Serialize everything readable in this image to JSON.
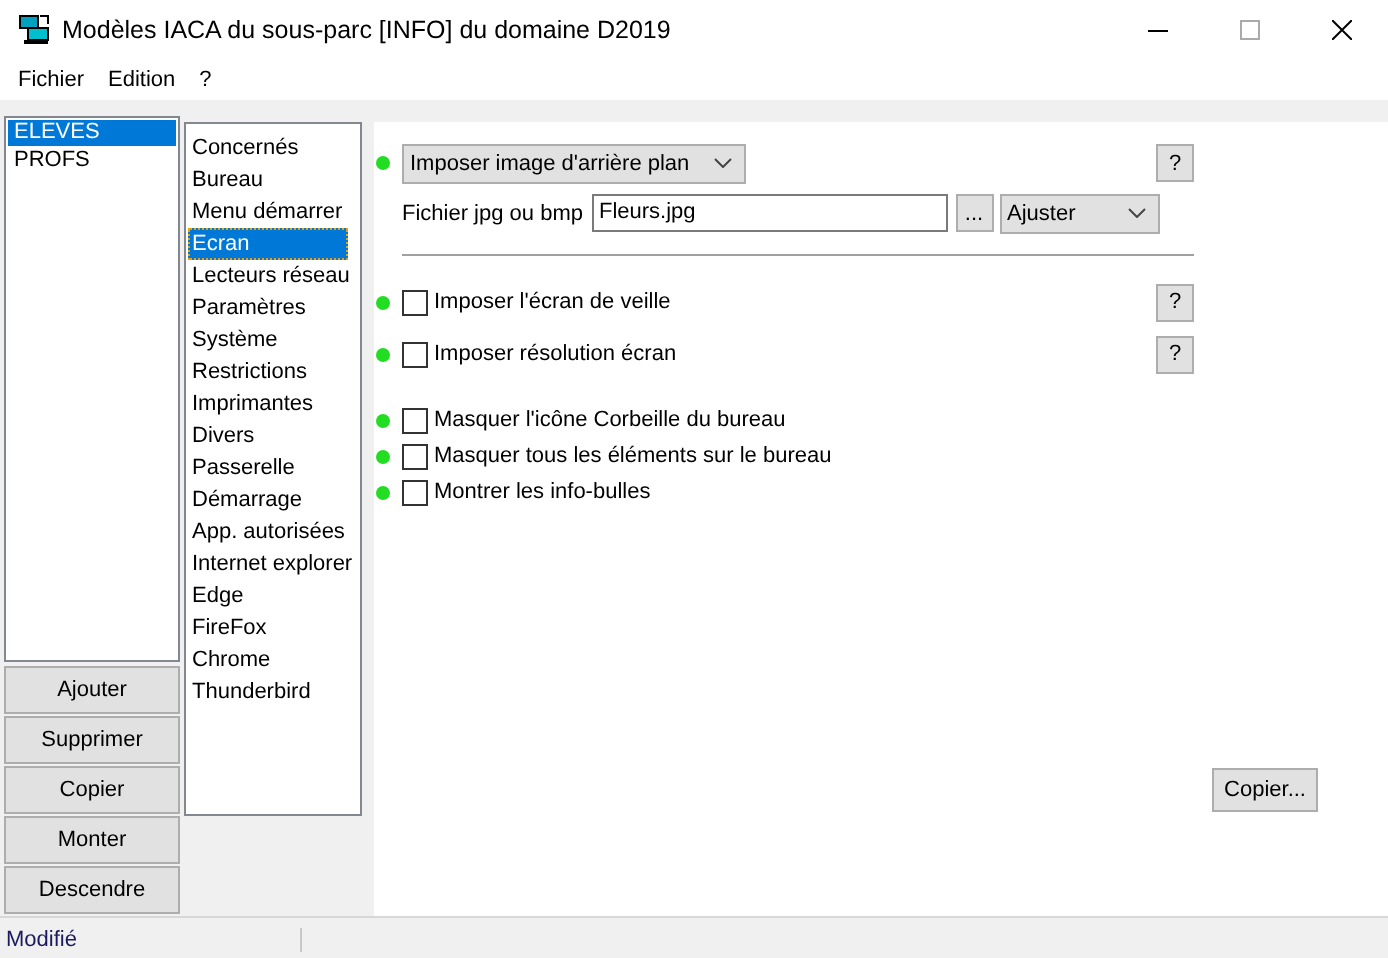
{
  "window": {
    "title": "Modèles IACA du sous-parc [INFO] du domaine D2019"
  },
  "menu": [
    "Fichier",
    "Edition",
    "?"
  ],
  "groups": [
    {
      "label": "ELEVES",
      "selected": true
    },
    {
      "label": "PROFS",
      "selected": false
    }
  ],
  "group_buttons": [
    "Ajouter",
    "Supprimer",
    "Copier",
    "Monter",
    "Descendre"
  ],
  "categories": [
    {
      "label": "Concernés",
      "selected": false
    },
    {
      "label": "Bureau",
      "selected": false
    },
    {
      "label": "Menu démarrer",
      "selected": false
    },
    {
      "label": "Ecran",
      "selected": true
    },
    {
      "label": "Lecteurs réseau",
      "selected": false
    },
    {
      "label": "Paramètres",
      "selected": false
    },
    {
      "label": "Système",
      "selected": false
    },
    {
      "label": "Restrictions",
      "selected": false
    },
    {
      "label": "Imprimantes",
      "selected": false
    },
    {
      "label": "Divers",
      "selected": false
    },
    {
      "label": "Passerelle",
      "selected": false
    },
    {
      "label": "Démarrage",
      "selected": false
    },
    {
      "label": "App. autorisées",
      "selected": false
    },
    {
      "label": "Internet explorer",
      "selected": false
    },
    {
      "label": "Edge",
      "selected": false
    },
    {
      "label": "FireFox",
      "selected": false
    },
    {
      "label": "Chrome",
      "selected": false
    },
    {
      "label": "Thunderbird",
      "selected": false
    }
  ],
  "options": [
    {
      "kind": "dropdown",
      "value": "Imposer image d'arrière plan",
      "help": "?"
    },
    {
      "kind": "file",
      "label": "Fichier jpg ou bmp",
      "value": "Fleurs.jpg",
      "browse": "...",
      "mode": "Ajuster"
    },
    {
      "kind": "separator"
    },
    {
      "kind": "checkbox",
      "label": "Imposer l'écran de veille",
      "checked": false,
      "help": "?"
    },
    {
      "kind": "checkbox",
      "label": "Imposer résolution écran",
      "checked": false,
      "help": "?"
    },
    {
      "kind": "gap"
    },
    {
      "kind": "checkbox",
      "label": "Masquer l'icône Corbeille du bureau",
      "checked": false
    },
    {
      "kind": "checkbox",
      "label": "Masquer tous les éléments sur le bureau",
      "checked": false
    },
    {
      "kind": "checkbox",
      "label": "Montrer les info-bulles",
      "checked": false
    }
  ],
  "copy_button": "Copier...",
  "status_bar": {
    "text": "Modifié"
  }
}
